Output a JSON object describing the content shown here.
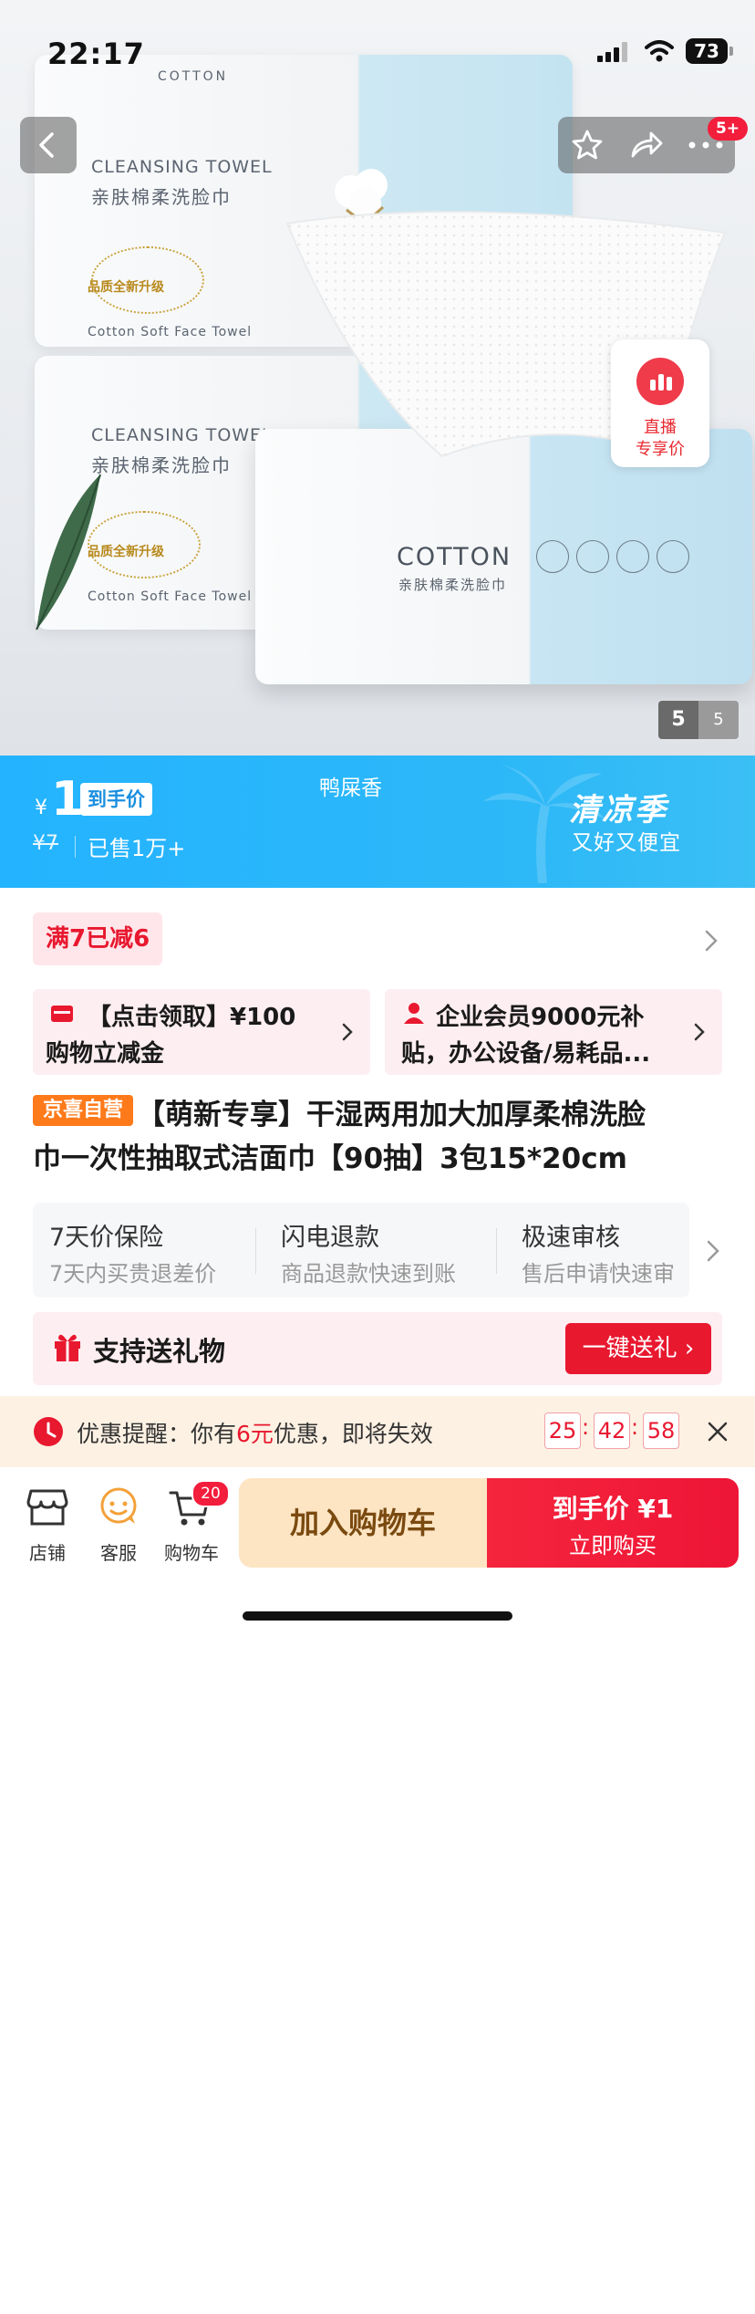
{
  "status_bar": {
    "time": "22:17",
    "battery": "73"
  },
  "nav": {
    "badge": "5+"
  },
  "hero": {
    "brand_top": "COTTON",
    "pack_title_en": "CLEANSING TOWEL",
    "pack_title_cn": "亲肤棉柔洗脸巾",
    "pack_stamp": "品质全新升级",
    "pack_sub": "Cotton Soft Face Towel",
    "front_brand": "COTTON",
    "front_cn": "亲肤棉柔洗脸巾",
    "live_label_line1": "直播",
    "live_label_line2": "专享价",
    "page_current": "5",
    "page_total": "5"
  },
  "price_banner": {
    "currency": "¥",
    "price": "1",
    "price_tag": "到手价",
    "original_price": "¥7",
    "sold": "已售1万+",
    "scent": "鸭屎香",
    "promo_title": "清凉季",
    "promo_sub": "又好又便宜"
  },
  "discount": {
    "label": "满7已减6"
  },
  "coupons": [
    {
      "text": "【点击领取】¥100购物立减金",
      "line1": "【点击领取】¥100",
      "line2": "购物立减金"
    },
    {
      "text": "企业会员9000元补贴，办公设备/易耗品...",
      "line1": "企业会员9000元补",
      "line2": "贴，办公设备/易耗品..."
    }
  ],
  "product": {
    "store_tag": "京喜自营",
    "title_line1": "【萌新专享】干湿两用加大加厚柔棉洗脸",
    "title_line2": "巾一次性抽取式洁面巾【90抽】3包15*20cm"
  },
  "services": [
    {
      "title": "7天价保险",
      "desc": "7天内买贵退差价"
    },
    {
      "title": "闪电退款",
      "desc": "商品退款快速到账"
    },
    {
      "title": "极速审核",
      "desc": "售后申请快速审"
    }
  ],
  "gift": {
    "label": "支持送礼物",
    "button": "一键送礼"
  },
  "reminder": {
    "prefix": "优惠提醒：你有",
    "amount": "6元",
    "suffix": "优惠，即将失效",
    "hh": "25",
    "mm": "42",
    "ss": "58"
  },
  "bottom_bar": {
    "store": "店铺",
    "service": "客服",
    "cart": "购物车",
    "cart_count": "20",
    "add_to_cart": "加入购物车",
    "buy_price": "到手价 ¥1",
    "buy_now": "立即购买"
  },
  "colors": {
    "accent": "#e8182f",
    "banner": "#2db8f7",
    "promo_orange": "#ff7a1a"
  }
}
